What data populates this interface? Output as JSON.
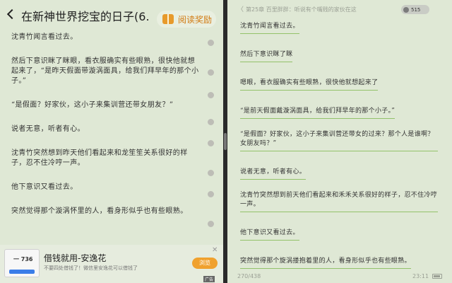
{
  "left": {
    "title": "在新神世界挖宝的日子(6…",
    "reward_label": "阅读奖励",
    "paragraphs": [
      "沈青竹闻言看过去。",
      "然后下意识眯了眯眼，看衣服确实有些眼熟，很快他就想起来了，“是昨天假面带漩涡面具，给我们拜早年的那个小子。”",
      "“是假面？好家伙，这小子来集训营还带女朋友？”",
      "说者无意，听者有心。",
      "沈青竹突然想到昨天他们看起来和龙笙笙关系很好的样子，忍不住冷哼一声。",
      "他下意识又看过去。",
      "突然觉得那个漩涡怀里的人，看身形似乎也有些眼熟。"
    ],
    "ad": {
      "thumb_text": "一 736",
      "title": "借钱就用-安逸花",
      "subtitle": "不要四处借钱了！微信里安逸花可以借钱了",
      "button": "浏览",
      "tag": "广告"
    }
  },
  "right": {
    "back": "〈",
    "chapter": "第25章 百里胖胖：听说有个嘴贱的家伙在这",
    "coins": "515",
    "paragraphs": [
      "沈青竹闻言看过去。",
      "然后下意识眯了眯",
      "嗯眼，看衣服确实有些眼熟，很快他就想起来了",
      "“是前天假面戴漩涡面具，给我们拜早年的那个小子。”",
      "“是假面？好家伙，这小子来集训营还带女的过来？那个人是谁啊？女朋友吗？”",
      "说者无意，听者有心。",
      "沈青竹突然想到前天他们看起来和禾禾关系很好的样子，忍不住冷哼一声。",
      "他下意识又看过去。",
      "突然觉得那个旋涡搂抱着里的人，看身形似乎也有些眼熟。"
    ],
    "page_indicator": "270/438",
    "time": "23:11"
  },
  "colors": {
    "background": "#dfe8d5",
    "accent": "#d27a12",
    "underline": "#93c26a"
  },
  "icons": [
    "back-icon",
    "gift-icon",
    "coin-icon",
    "battery-icon",
    "close-icon"
  ]
}
